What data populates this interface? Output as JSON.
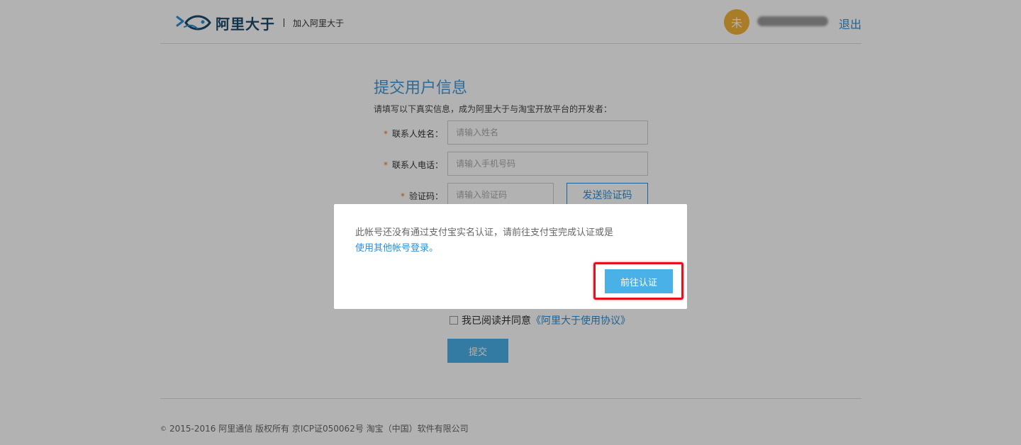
{
  "header": {
    "logo_text": "阿里大于",
    "logo_subtitle": "加入阿里大于",
    "avatar_char": "未",
    "logout_label": "退出"
  },
  "form": {
    "title": "提交用户信息",
    "description": "请填写以下真实信息，成为阿里大于与淘宝开放平台的开发者：",
    "required_mark": "*",
    "fields": [
      {
        "label": "联系人姓名：",
        "placeholder": "请输入姓名",
        "value": ""
      },
      {
        "label": "联系人电话：",
        "placeholder": "请输入手机号码",
        "value": ""
      },
      {
        "label": "验证码：",
        "placeholder": "请输入验证码",
        "value": ""
      }
    ],
    "send_code_label": "发送验证码",
    "agree_prefix": "我已阅读并同意",
    "agree_link": "《阿里大于使用协议》",
    "agree_checked": false,
    "submit_label": "提交"
  },
  "footer": {
    "copyright_symbol": "©",
    "text": "2015-2016 阿里通信 版权所有 京ICP证050062号 淘宝（中国）软件有限公司"
  },
  "modal": {
    "message": "此帐号还没有通过支付宝实名认证，请前往支付宝完成认证或是",
    "link_text": "使用其他帐号登录。",
    "button_label": "前往认证"
  },
  "colors": {
    "accent": "#2a8ed8",
    "button_blue": "#4ab0e8",
    "avatar_orange": "#f3b238",
    "required_orange": "#f27b14",
    "highlight_red": "#e8101a"
  },
  "icons": {
    "logo": "fish-logo-icon",
    "checkbox": "checkbox-icon"
  }
}
